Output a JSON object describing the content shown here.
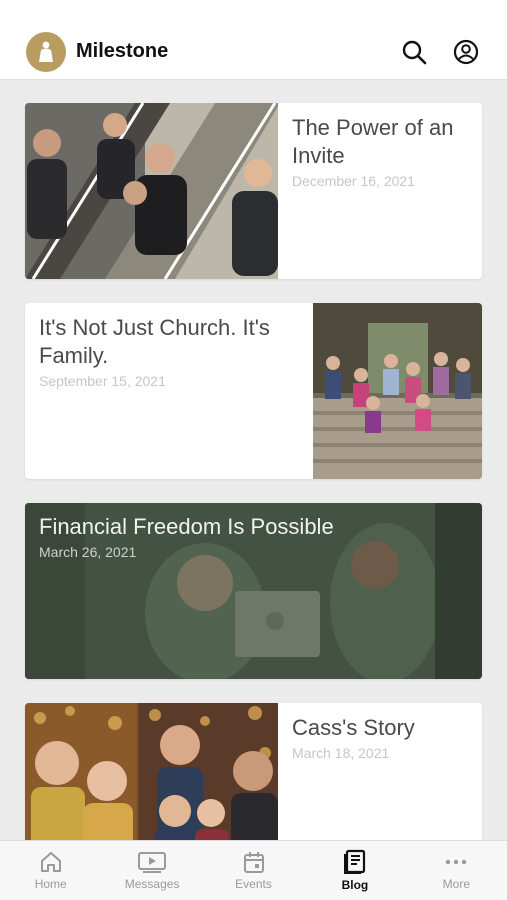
{
  "app": {
    "title": "Milestone"
  },
  "posts": [
    {
      "title": "The Power of an Invite",
      "date": "December 16, 2021"
    },
    {
      "title": "It's Not Just Church. It's Family.",
      "date": "September 15, 2021"
    },
    {
      "title": "Financial Freedom Is Possible",
      "date": "March 26, 2021"
    },
    {
      "title": "Cass's Story",
      "date": "March 18, 2021"
    }
  ],
  "tabs": [
    {
      "label": "Home",
      "icon": "home-icon"
    },
    {
      "label": "Messages",
      "icon": "play-icon"
    },
    {
      "label": "Events",
      "icon": "calendar-icon"
    },
    {
      "label": "Blog",
      "icon": "blog-icon",
      "active": true
    },
    {
      "label": "More",
      "icon": "more-icon"
    }
  ],
  "colors": {
    "accent": "#b89c60",
    "active_tab": "#111111",
    "inactive_tab": "#9a9a9a"
  }
}
